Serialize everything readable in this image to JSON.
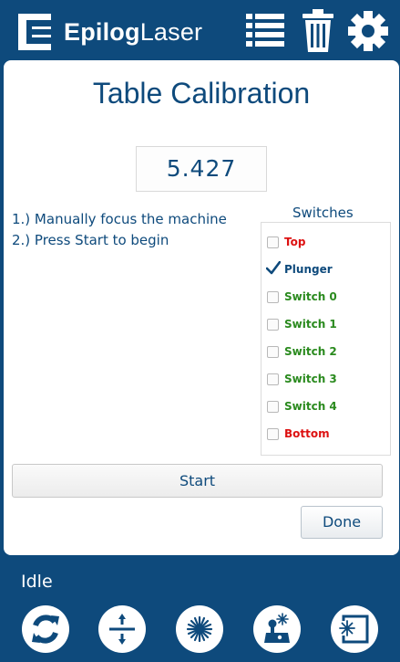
{
  "header": {
    "logo": {
      "bold": "Epilog",
      "regular": "Laser"
    },
    "icons": [
      "list-icon",
      "trash-icon",
      "gear-icon"
    ]
  },
  "main": {
    "title": "Table Calibration",
    "value": "5.427",
    "instructions": [
      "1.) Manually focus the machine",
      "2.) Press Start to begin"
    ],
    "switches": {
      "title": "Switches",
      "items": [
        {
          "label": "Top",
          "checked": false,
          "color": "#dd1111"
        },
        {
          "label": "Plunger",
          "checked": true,
          "color": "#0e4a7c"
        },
        {
          "label": "Switch 0",
          "checked": false,
          "color": "#2a8a1e"
        },
        {
          "label": "Switch 1",
          "checked": false,
          "color": "#2a8a1e"
        },
        {
          "label": "Switch 2",
          "checked": false,
          "color": "#2a8a1e"
        },
        {
          "label": "Switch 3",
          "checked": false,
          "color": "#2a8a1e"
        },
        {
          "label": "Switch 4",
          "checked": false,
          "color": "#2a8a1e"
        },
        {
          "label": "Bottom",
          "checked": false,
          "color": "#dd1111"
        }
      ]
    },
    "start_label": "Start",
    "done_label": "Done"
  },
  "footer": {
    "status": "Idle",
    "buttons": [
      "refresh-icon",
      "focus-icon",
      "laser-icon",
      "joystick-icon",
      "laser-frame-icon"
    ]
  },
  "colors": {
    "brand": "#0e4a7c",
    "panel": "#ffffff",
    "red": "#dd1111",
    "green": "#2a8a1e"
  }
}
